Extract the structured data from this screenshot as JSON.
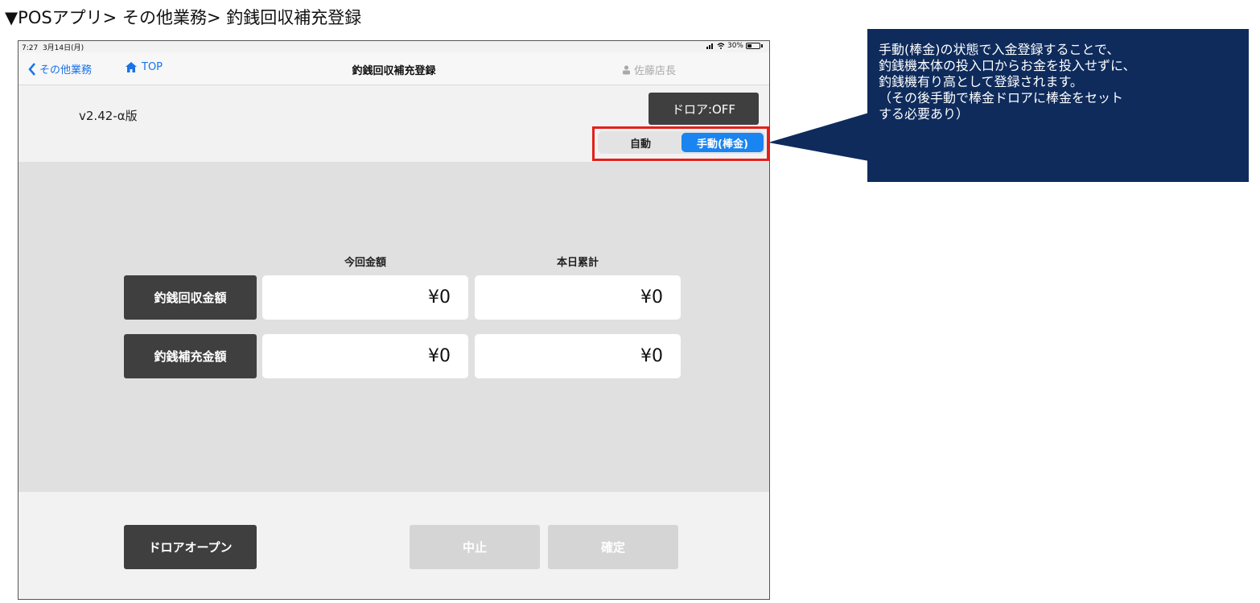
{
  "page_heading": "▼POSアプリ> その他業務> 釣銭回収補充登録",
  "status_bar": {
    "time": "7:27",
    "date": "3月14日(月)",
    "signal_icon": "signal-bars-icon",
    "wifi_icon": "wifi-icon",
    "battery": "30%"
  },
  "nav": {
    "back_label": "その他業務",
    "home_label": "TOP",
    "title": "釣銭回収補充登録",
    "user": "佐藤店長"
  },
  "version": "v2.42-α版",
  "drawer_state": "ドロア:OFF",
  "mode": {
    "options": [
      "自動",
      "手動(棒金)"
    ],
    "selected": "手動(棒金)"
  },
  "table": {
    "headers": [
      "今回金額",
      "本日累計"
    ],
    "rows": [
      {
        "label": "釣銭回収金額",
        "current": "¥0",
        "total": "¥0"
      },
      {
        "label": "釣銭補充金額",
        "current": "¥0",
        "total": "¥0"
      }
    ]
  },
  "buttons": {
    "drawer_open": "ドロアオープン",
    "cancel": "中止",
    "confirm": "確定"
  },
  "callout": {
    "lines": [
      "手動(棒金)の状態で入金登録することで、",
      "釣銭機本体の投入口からお金を投入せずに、",
      "釣銭機有り高として登録されます。",
      "（その後手動で棒金ドロアに棒金をセット",
      "する必要あり）"
    ]
  },
  "colors": {
    "accent_blue": "#1a84f0",
    "dark_button": "#3f3f3f",
    "highlight_red": "#e3201b",
    "callout_navy": "#0e2b5c"
  }
}
